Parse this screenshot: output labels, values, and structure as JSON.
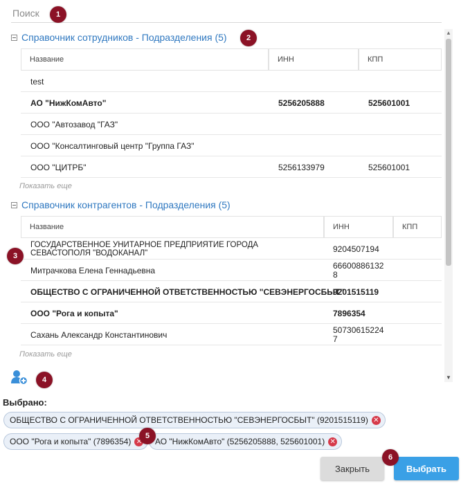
{
  "search": {
    "placeholder": "Поиск"
  },
  "employees": {
    "title": "Справочник сотрудников - Подразделения (5)",
    "headers": [
      "Название",
      "ИНН",
      "КПП"
    ],
    "rows": [
      {
        "name": "test",
        "inn": "",
        "kpp": "",
        "bold": false
      },
      {
        "name": "АО \"НижКомАвто\"",
        "inn": "5256205888",
        "kpp": "525601001",
        "bold": true
      },
      {
        "name": "ООО \"Автозавод \"ГАЗ\"",
        "inn": "",
        "kpp": "",
        "bold": false
      },
      {
        "name": "ООО \"Консалтинговый центр \"Группа ГАЗ\"",
        "inn": "",
        "kpp": "",
        "bold": false
      },
      {
        "name": "ООО \"ЦИТРБ\"",
        "inn": "5256133979",
        "kpp": "525601001",
        "bold": false
      }
    ],
    "show_more": "Показать еще"
  },
  "contractors": {
    "title": "Справочник контрагентов - Подразделения (5)",
    "headers": [
      "Название",
      "ИНН",
      "КПП"
    ],
    "rows": [
      {
        "name": "ГОСУДАРСТВЕННОЕ УНИТАРНОЕ ПРЕДПРИЯТИЕ ГОРОДА СЕВАСТОПОЛЯ \"ВОДОКАНАЛ\"",
        "inn": "9204507194",
        "kpp": "",
        "bold": false
      },
      {
        "name": "Митрачкова Елена Геннадьевна",
        "inn": "666008861328",
        "kpp": "",
        "bold": false
      },
      {
        "name": "ОБЩЕСТВО С ОГРАНИЧЕННОЙ ОТВЕТСТВЕННОСТЬЮ \"СЕВЭНЕРГОСБЫТ\"",
        "inn": "9201515119",
        "kpp": "",
        "bold": true
      },
      {
        "name": "ООО \"Рога и копыта\"",
        "inn": "7896354",
        "kpp": "",
        "bold": true
      },
      {
        "name": "Сахань Александр Константинович",
        "inn": "507306152247",
        "kpp": "",
        "bold": false
      }
    ],
    "show_more": "Показать еще"
  },
  "selected": {
    "label": "Выбрано:",
    "chips": [
      "ОБЩЕСТВО С ОГРАНИЧЕННОЙ ОТВЕТСТВЕННОСТЬЮ \"СЕВЭНЕРГОСБЫТ\" (9201515119)",
      "ООО \"Рога и копыта\" (7896354)",
      "АО \"НижКомАвто\" (5256205888, 525601001)"
    ]
  },
  "buttons": {
    "close": "Закрыть",
    "select": "Выбрать"
  },
  "markers": [
    "1",
    "2",
    "3",
    "4",
    "5",
    "6"
  ],
  "colors": {
    "link": "#2f78c0",
    "primary": "#3aa0e6",
    "marker": "#8b1226",
    "remove": "#d63a4a"
  },
  "icons": [
    "collapse-icon",
    "add-user-icon",
    "remove-icon"
  ]
}
